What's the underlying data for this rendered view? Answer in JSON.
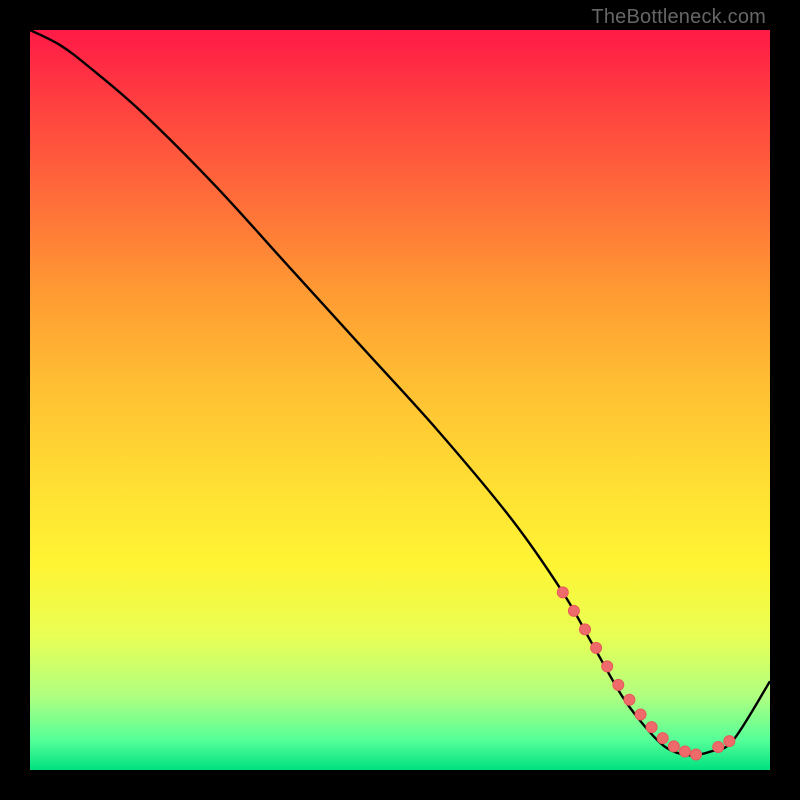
{
  "watermark": "TheBottleneck.com",
  "colors": {
    "line": "#000000",
    "dot": "#ef6b6b",
    "dot_stroke": "#e85a5a"
  },
  "chart_data": {
    "type": "line",
    "title": "",
    "xlabel": "",
    "ylabel": "",
    "xlim": [
      0,
      100
    ],
    "ylim": [
      0,
      100
    ],
    "series": [
      {
        "name": "bottleneck-curve",
        "x": [
          0,
          4,
          8,
          15,
          25,
          35,
          45,
          55,
          65,
          72,
          76,
          80,
          83,
          86,
          89,
          92,
          95,
          100
        ],
        "y": [
          100,
          98,
          95,
          89,
          79,
          68,
          57,
          46,
          34,
          24,
          17,
          10,
          6,
          3,
          2,
          2.5,
          4,
          12
        ]
      }
    ],
    "markers": {
      "name": "highlight-dots",
      "x": [
        72,
        73.5,
        75,
        76.5,
        78,
        79.5,
        81,
        82.5,
        84,
        85.5,
        87,
        88.5,
        90,
        93,
        94.5
      ],
      "y": [
        24,
        21.5,
        19,
        16.5,
        14,
        11.5,
        9.5,
        7.5,
        5.8,
        4.3,
        3.2,
        2.5,
        2.1,
        3.1,
        3.9
      ]
    }
  }
}
